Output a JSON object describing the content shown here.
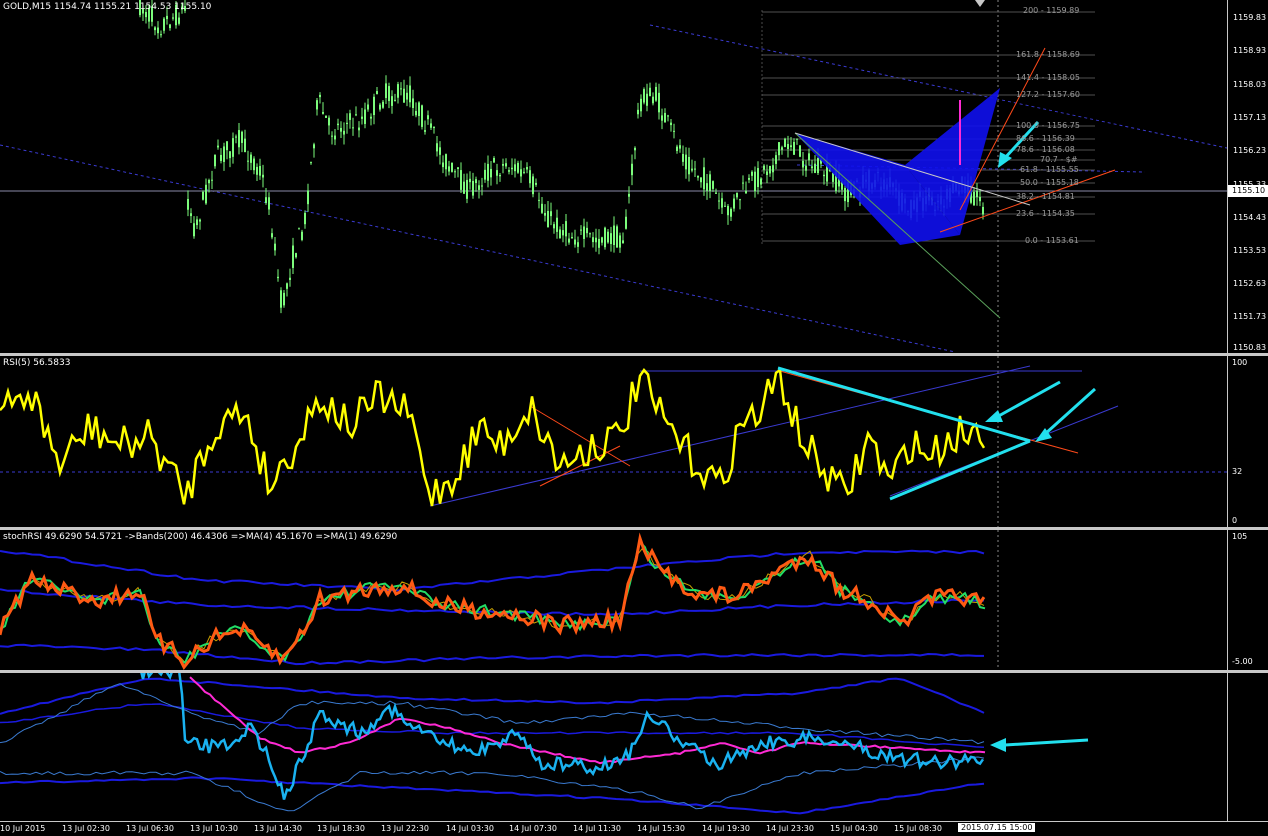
{
  "main": {
    "title": "GOLD,M15  1154.74 1155.21 1154.53 1155.10",
    "current_price": "1155.10",
    "price_labels": [
      "1159.83",
      "1158.93",
      "1158.03",
      "1157.13",
      "1156.23",
      "1155.33",
      "1154.43",
      "1153.53",
      "1152.63",
      "1151.73",
      "1150.83"
    ],
    "fib_labels": [
      "200 - 1159.89",
      "161.8 - 1158.69",
      "141.4 - 1158.05",
      "127.2 - 1157.60",
      "100.0 - 1156.75",
      "86.6 - 1156.39",
      "78.6 - 1156.08",
      "70.7 - $#",
      "61.8 - 1155.55",
      "50.0 - 1155.18",
      "38.2 - 1154.81",
      "23.6 - 1154.35",
      "0.0 - 1153.61"
    ]
  },
  "rsi": {
    "title": "RSI(5) 56.5833",
    "levels": [
      "100",
      "32",
      "0"
    ]
  },
  "stoch": {
    "title": "stochRSI 49.6290 54.5721  ->Bands(200) 46.4306  =>MA(4) 45.1670  =>MA(1) 49.6290",
    "levels": [
      "105",
      "-5.00"
    ]
  },
  "xaxis": {
    "labels": [
      "10 Jul 2015",
      "13 Jul 02:30",
      "13 Jul 06:30",
      "13 Jul 10:30",
      "13 Jul 14:30",
      "13 Jul 18:30",
      "13 Jul 22:30",
      "14 Jul 03:30",
      "14 Jul 07:30",
      "14 Jul 11:30",
      "14 Jul 15:30",
      "14 Jul 19:30",
      "14 Jul 23:30",
      "15 Jul 04:30",
      "15 Jul 08:30"
    ],
    "cursor_label": "2015.07.15 15:00"
  },
  "colors": {
    "background": "#000000",
    "candle": "#7cfc7c",
    "rsi_line": "#ffff00",
    "arrows": "#22e0ee",
    "pattern_fill": "#1010ee",
    "stoch_main": "#ff5a14",
    "stoch_signal": "#22dd66",
    "bands": "#1a1adf",
    "ma_pink": "#ff2ad4",
    "stoch_blue": "#1ab2f0"
  }
}
